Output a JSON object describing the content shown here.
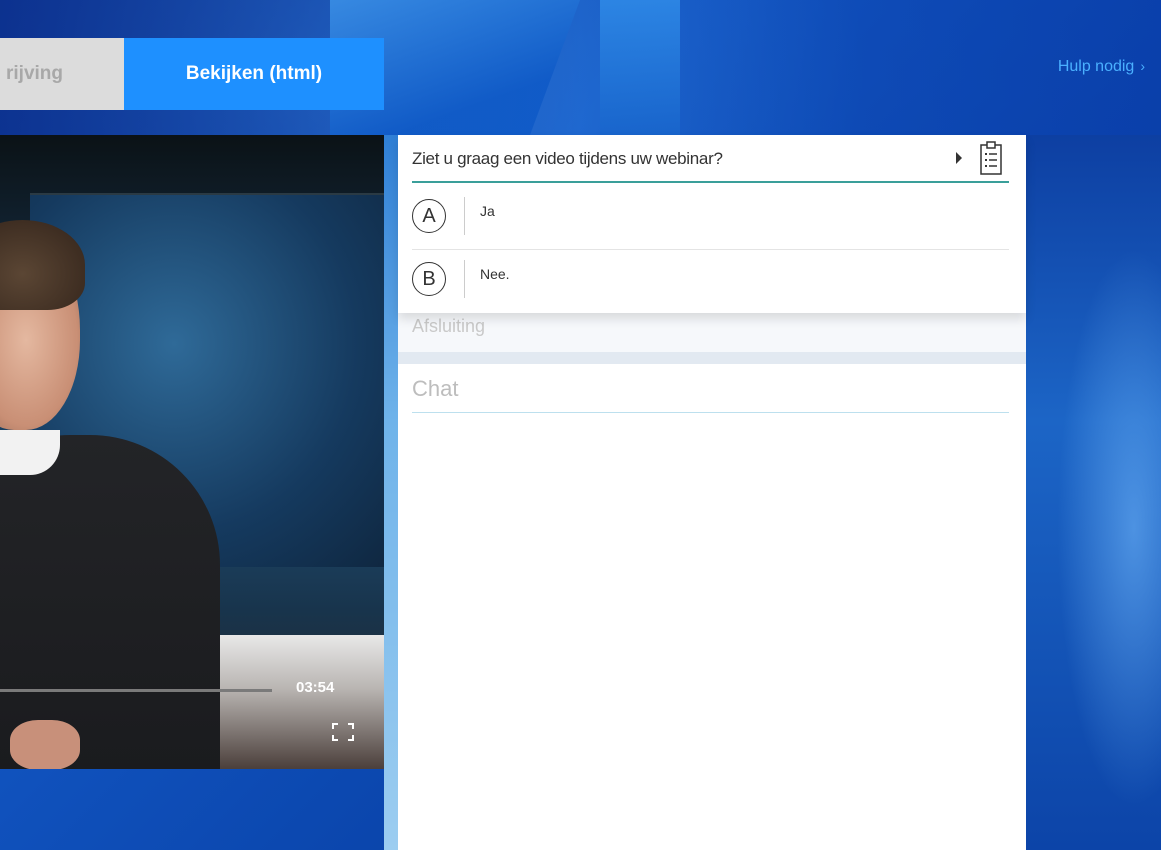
{
  "header": {
    "tabs": [
      {
        "label": "rijving",
        "active": false
      },
      {
        "label": "Bekijken (html)",
        "active": true
      }
    ],
    "help_link": "Hulp nodig",
    "help_chevron": "›"
  },
  "video": {
    "time": "03:54"
  },
  "poll": {
    "question": "Ziet u graag een video tijdens uw webinar?",
    "options": [
      {
        "letter": "A",
        "text": "Ja"
      },
      {
        "letter": "B",
        "text": "Nee."
      }
    ]
  },
  "sections": {
    "afsluiting": "Afsluiting",
    "chat": "Chat"
  },
  "colors": {
    "accent": "#1e90ff",
    "poll_line": "#3a9f9a",
    "help_link": "#4ab0ff"
  }
}
